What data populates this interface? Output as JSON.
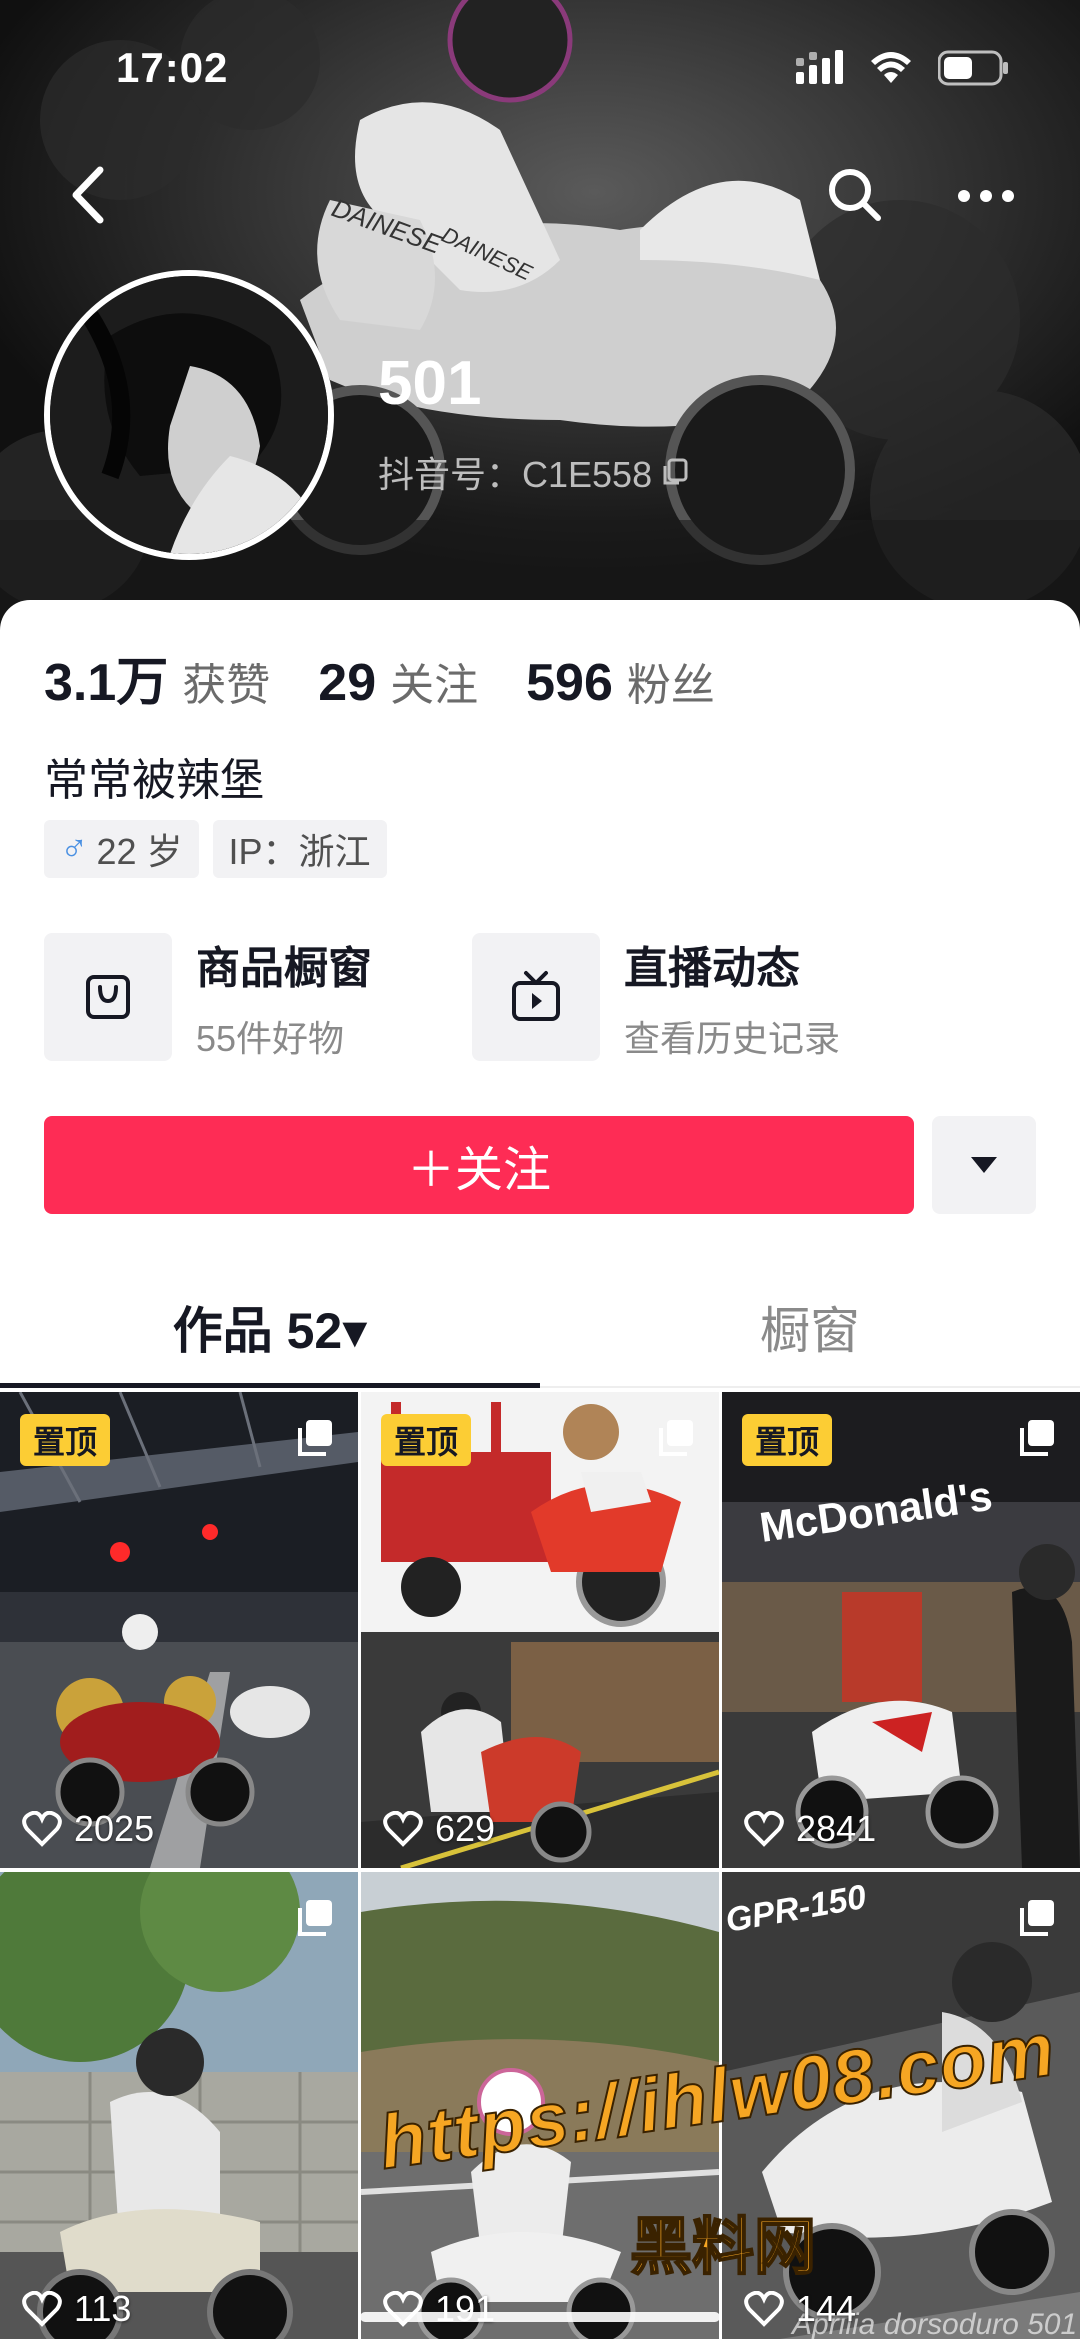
{
  "status_bar": {
    "time": "17:02"
  },
  "profile": {
    "username": "501",
    "douyin_id": "抖音号：C1E558",
    "bio": "常常被辣堡"
  },
  "stats": [
    {
      "value": "3.1万",
      "label": "获赞"
    },
    {
      "value": "29",
      "label": "关注"
    },
    {
      "value": "596",
      "label": "粉丝"
    }
  ],
  "tags": {
    "gender_icon": "♂",
    "age": "22 岁",
    "ip": "IP：浙江"
  },
  "shortcuts": [
    {
      "title": "商品橱窗",
      "subtitle": "55件好物",
      "icon": "shopping-bag-icon"
    },
    {
      "title": "直播动态",
      "subtitle": "查看历史记录",
      "icon": "tv-icon"
    }
  ],
  "follow_button": {
    "label": "＋关注"
  },
  "tabs": [
    {
      "label": "作品 52▾",
      "active": true
    },
    {
      "label": "橱窗",
      "active": false
    }
  ],
  "posts": [
    {
      "pinned": "置顶",
      "likes": "2025"
    },
    {
      "pinned": "置顶",
      "likes": "629"
    },
    {
      "pinned": "置顶",
      "likes": "2841"
    },
    {
      "pinned": "",
      "likes": "113"
    },
    {
      "pinned": "",
      "likes": "191"
    },
    {
      "pinned": "",
      "likes": "144"
    }
  ],
  "post_texts": {
    "mcdonalds": "McDonald's",
    "gpr": "GPR-150",
    "caption": "Aprilia dorsoduro 501"
  },
  "watermark": {
    "url": "https://ihlw08.com",
    "name": "黑料网"
  },
  "colors": {
    "accent": "#fe2c55",
    "pin_badge": "#fccd34",
    "watermark": "#f6a623"
  }
}
